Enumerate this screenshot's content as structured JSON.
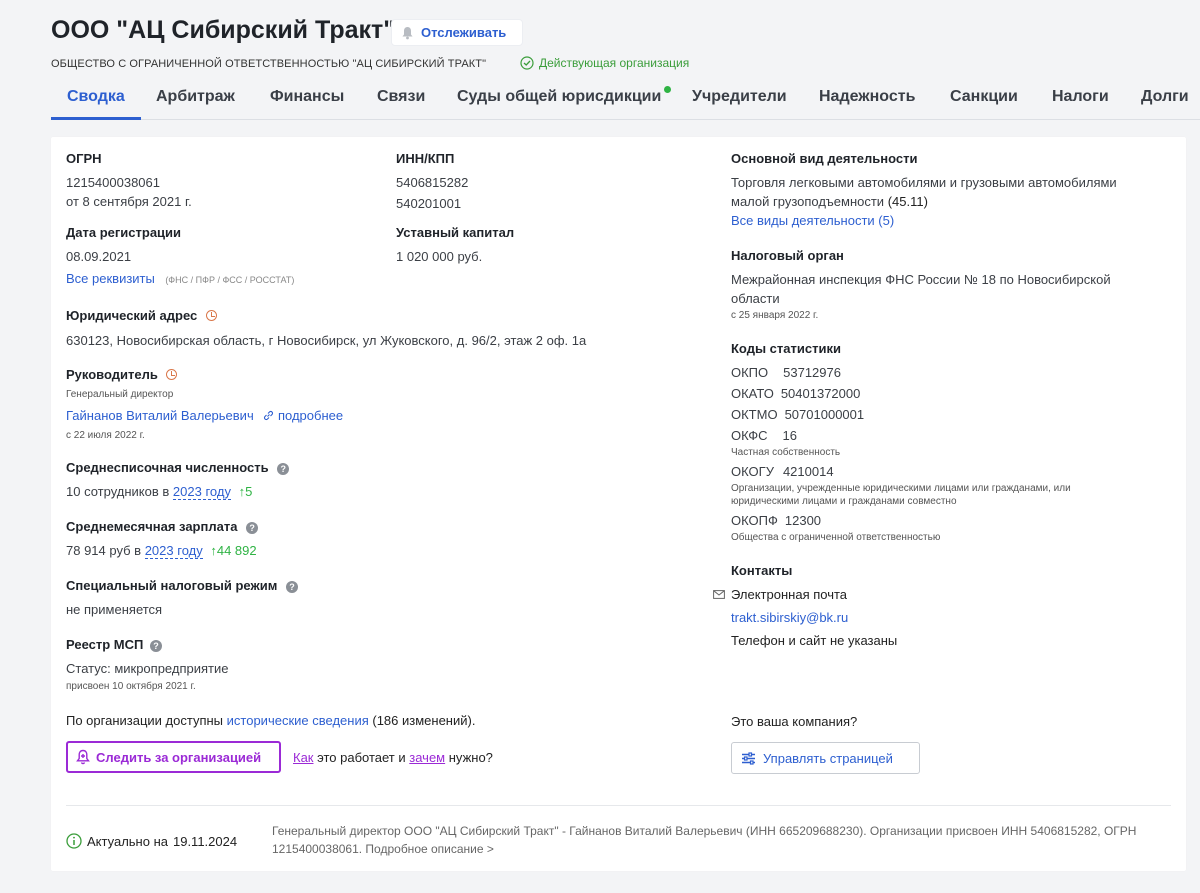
{
  "header": {
    "title": "ООО \"АЦ Сибирский Тракт\"",
    "follow_label": "Отслеживать",
    "full_name": "ОБЩЕСТВО С ОГРАНИЧЕННОЙ ОТВЕТСТВЕННОСТЬЮ \"АЦ СИБИРСКИЙ ТРАКТ\"",
    "status": "Действующая организация"
  },
  "tabs": [
    "Сводка",
    "Арбитраж",
    "Финансы",
    "Связи",
    "Суды общей юрисдикции",
    "Учредители",
    "Надежность",
    "Санкции",
    "Налоги",
    "Долги"
  ],
  "ogrn": {
    "label": "ОГРН",
    "value": "1215400038061",
    "date": "от 8 сентября 2021 г."
  },
  "inn": {
    "label": "ИНН/КПП",
    "inn": "5406815282",
    "kpp": "540201001"
  },
  "registration": {
    "label": "Дата регистрации",
    "value": "08.09.2021"
  },
  "capital": {
    "label": "Уставный капитал",
    "value": "1 020 000 руб."
  },
  "requisites": {
    "link": "Все реквизиты",
    "sources": "(ФНС / ПФР / ФСС / РОССТАТ)"
  },
  "address": {
    "label": "Юридический адрес",
    "value": "630123, Новосибирская область, г Новосибирск, ул Жуковского, д. 96/2, этаж 2 оф. 1а"
  },
  "director": {
    "label": "Руководитель",
    "position": "Генеральный директор",
    "name": "Гайнанов Виталий Валерьевич",
    "more": "подробнее",
    "since": "с 22 июля 2022 г."
  },
  "employees": {
    "label": "Среднесписочная численность",
    "prefix": "10 сотрудников в",
    "year": "2023 году",
    "delta": "↑5"
  },
  "salary": {
    "label": "Среднемесячная зарплата",
    "prefix": "78 914 руб в",
    "year": "2023 году",
    "delta": "↑44 892"
  },
  "tax_regime": {
    "label": "Специальный налоговый режим",
    "value": "не применяется"
  },
  "msp": {
    "label": "Реестр МСП",
    "status": "Статус: микропредприятие",
    "assigned": "присвоен 10 октября 2021 г."
  },
  "activity": {
    "label": "Основной вид деятельности",
    "line1": "Торговля легковыми автомобилями и грузовыми автомобилями",
    "line2": "малой грузоподъемности",
    "code": "(45.11)",
    "all_link": "Все виды деятельности (5)"
  },
  "tax_authority": {
    "label": "Налоговый орган",
    "line1": "Межрайонная инспекция ФНС России № 18 по Новосибирской",
    "line2": "области",
    "since": "с 25 января 2022 г."
  },
  "stat_codes": {
    "label": "Коды статистики",
    "okpo_k": "ОКПО",
    "okpo_v": "53712976",
    "okato_k": "ОКАТО",
    "okato_v": "50401372000",
    "oktmo_k": "ОКТМО",
    "oktmo_v": "50701000001",
    "okfs_k": "ОКФС",
    "okfs_v": "16",
    "okfs_desc": "Частная собственность",
    "okogu_k": "ОКОГУ",
    "okogu_v": "4210014",
    "okogu_desc1": "Организации, учрежденные юридическими лицами или гражданами, или",
    "okogu_desc2": "юридическими лицами и гражданами совместно",
    "okopf_k": "ОКОПФ",
    "okopf_v": "12300",
    "okopf_desc": "Общества с ограниченной ответственностью"
  },
  "contacts": {
    "label": "Контакты",
    "email_label": "Электронная почта",
    "email": "trakt.sibirskiy@bk.ru",
    "no_phone": "Телефон и сайт не указаны"
  },
  "history": {
    "prefix": "По организации доступны",
    "link": "исторические сведения",
    "count": "(186 изменений)."
  },
  "actions": {
    "track_button": "Следить за организацией",
    "how": "Как",
    "middle": "это работает и",
    "why": "зачем",
    "suffix": "нужно?",
    "your_company": "Это ваша компания?",
    "manage_button": "Управлять страницей"
  },
  "footer": {
    "actual_prefix": "Актуально на",
    "actual_date": "19.11.2024",
    "description": "Генеральный директор ООО \"АЦ Сибирский Тракт\" - Гайнанов Виталий Валерьевич (ИНН 665209688230). Организации присвоен ИНН 5406815282, ОГРН 1215400038061. Подробное описание >"
  },
  "colors": {
    "accent": "#2d5fd0",
    "success": "#2fb344",
    "purple": "#9b2ad6",
    "warning": "#d9774a"
  }
}
